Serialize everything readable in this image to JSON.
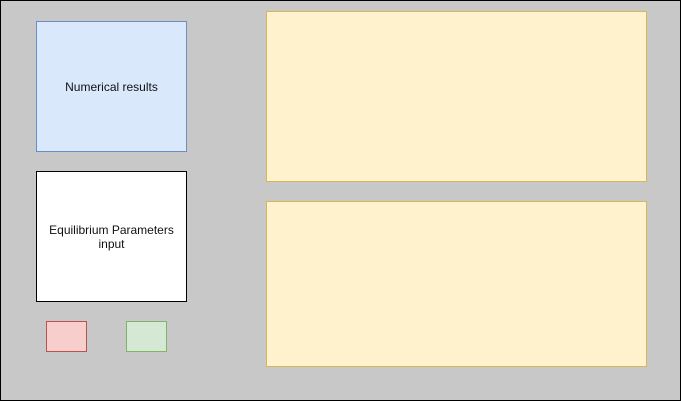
{
  "boxes": {
    "numerical_results": {
      "label": "Numerical results",
      "fill": "#dae8fc",
      "stroke": "#6c8ebf"
    },
    "equilibrium_parameters": {
      "label": "Equilibrium Parameters input",
      "fill": "#ffffff",
      "stroke": "#000000"
    },
    "red_button": {
      "fill": "#f8cecc",
      "stroke": "#b85450"
    },
    "green_button": {
      "fill": "#d5e8d4",
      "stroke": "#82b366"
    },
    "plot_panels": {
      "fill": "#fff2cc",
      "stroke": "#d6b656"
    }
  },
  "canvas": {
    "background": "#c8c8c8"
  }
}
